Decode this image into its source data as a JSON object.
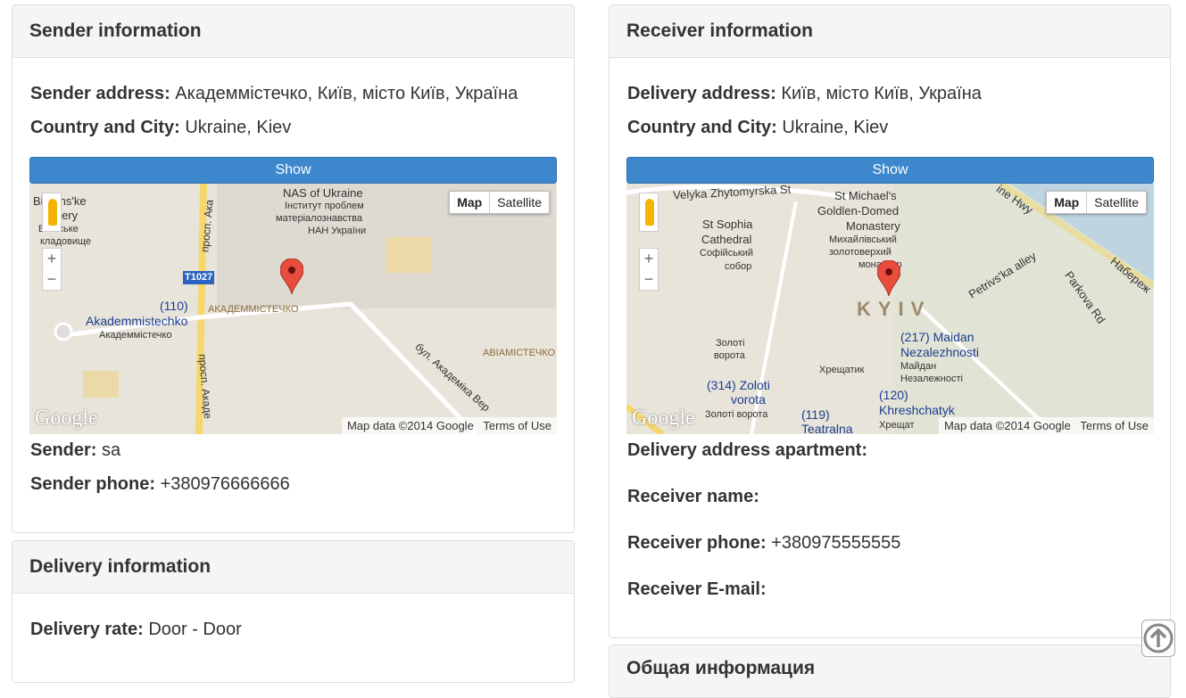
{
  "sender": {
    "title": "Sender information",
    "address_label": "Sender address:",
    "address": "Академмістечко, Київ, місто Київ, Україна",
    "country_label": "Country and City:",
    "country": "Ukraine, Kiev",
    "show_label": "Show",
    "name_label": "Sender:",
    "name": "sa",
    "phone_label": "Sender phone:",
    "phone": "+380976666666",
    "map": {
      "type_map": "Map",
      "type_satellite": "Satellite",
      "attribution": "Map data ©2014 Google",
      "terms": "Terms of Use",
      "logo": "Google",
      "labels": [
        "Bi   nans'ke",
        "  netery",
        "Б   анське",
        "кладовище",
        "NAS of Ukraine",
        "Інститут проблем",
        "матеріалознавства",
        "НАН України",
        "T1027",
        "(110)",
        "Akademmistechko",
        "Академмістечко",
        "АКАДЕММІСТЕЧКО",
        "АВІАМІСТЕЧКО",
        "бул. Академіка Вер",
        "просп. Ака",
        "просп. Акаде"
      ]
    }
  },
  "receiver": {
    "title": "Receiver information",
    "address_label": "Delivery address:",
    "address": "Київ, місто Київ, Україна",
    "country_label": "Country and City:",
    "country": "Ukraine, Kiev",
    "show_label": "Show",
    "apartment_label": "Delivery address apartment:",
    "name_label": "Receiver name:",
    "phone_label": "Receiver phone:",
    "phone": "+380975555555",
    "email_label": "Receiver E-mail:",
    "map": {
      "type_map": "Map",
      "type_satellite": "Satellite",
      "attribution": "Map data ©2014 Google",
      "terms": "Terms of Use",
      "logo": "Google",
      "labels": [
        "Velyka Zhytomyrska St",
        "St Michael's",
        "Goldlen-Domed",
        "Monastery",
        "Михайлівський",
        "золотоверхий",
        "монастир",
        "St Sophia",
        "Cathedral",
        "Софійський",
        "собор",
        "KYIV",
        "Petrivs'ka alley",
        "Parkova Rd",
        "Набереж",
        "ine Hwy",
        "Золоті",
        "ворота",
        "Хрещатик",
        "(217) Maidan",
        "Nezalezhnosti",
        "Майдан",
        "Незалежності",
        "(314) Zoloti",
        "vorota",
        "Золоті ворота",
        "(120)",
        "Khreshchatyk",
        "Хрещат",
        "(119)",
        "Teatralna"
      ]
    }
  },
  "delivery": {
    "title": "Delivery information",
    "rate_label": "Delivery rate:",
    "rate": "Door - Door"
  },
  "general": {
    "title": "Общая информация"
  },
  "colors": {
    "button": "#3d87cc",
    "panel_header": "#f5f5f5"
  }
}
